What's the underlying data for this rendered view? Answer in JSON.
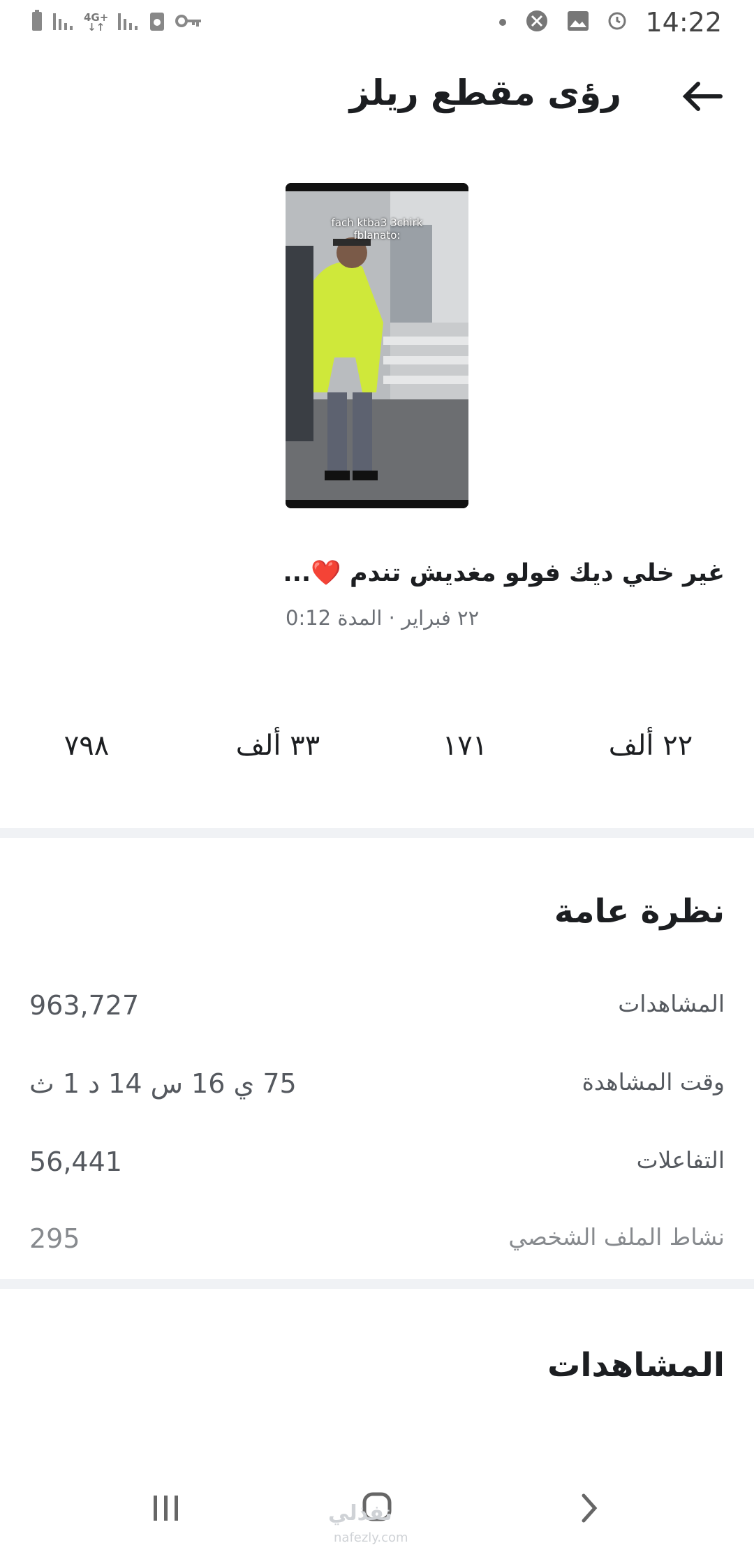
{
  "status_bar": {
    "time": "14:22",
    "network": "4G+",
    "icons": [
      "battery-icon",
      "signal-icon",
      "network-4g-icon",
      "signal-2-icon",
      "storage-icon",
      "vpn-key-icon",
      "dot-icon",
      "browser-icon",
      "gallery-icon",
      "alarm-icon"
    ]
  },
  "header": {
    "title": "رؤى مقطع ريلز",
    "back_icon": "arrow-back-icon"
  },
  "reel": {
    "thumbnail_text_line1": "fach ktba3 3chirk",
    "thumbnail_text_line2": "fblanato:",
    "caption": "غير خلي ديك فولو مغديش تندم ❤️...",
    "meta": "٢٢ فبراير · المدة 0:12"
  },
  "stats": [
    {
      "value": "٢٢ ألف"
    },
    {
      "value": "١٧١"
    },
    {
      "value": "٣٣ ألف"
    },
    {
      "value": "٧٩٨"
    }
  ],
  "overview": {
    "title": "نظرة عامة",
    "rows": [
      {
        "label": "المشاهدات",
        "value": "963,727"
      },
      {
        "label": "وقت المشاهدة",
        "value": "75 ي 16 س 14 د 1 ث"
      },
      {
        "label": "التفاعلات",
        "value": "56,441"
      },
      {
        "label": "نشاط الملف الشخصي",
        "value": "295"
      }
    ]
  },
  "views_section": {
    "title": "المشاهدات"
  },
  "nav_bar": {
    "icons": [
      "recent-apps-icon",
      "home-icon",
      "back-chevron-icon"
    ]
  },
  "watermark": {
    "text": "نفذلي",
    "url": "nafezly.com"
  },
  "colors": {
    "text_primary": "#1c1e21",
    "text_secondary": "#55595f",
    "divider": "#f0f2f5",
    "heart": "#e41e3f"
  }
}
